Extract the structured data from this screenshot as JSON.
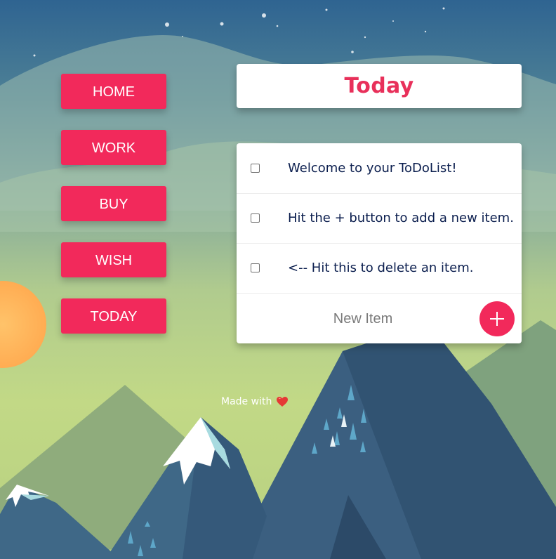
{
  "nav": {
    "items": [
      {
        "label": "HOME"
      },
      {
        "label": "WORK"
      },
      {
        "label": "BUY"
      },
      {
        "label": "WISH"
      },
      {
        "label": "TODAY"
      }
    ]
  },
  "header": {
    "title": "Today"
  },
  "todo": {
    "items": [
      {
        "text": "Welcome to your ToDoList!",
        "checked": false
      },
      {
        "text": "Hit the + button to add a new item.",
        "checked": false
      },
      {
        "text": "<-- Hit this to delete an item.",
        "checked": false
      }
    ],
    "new_item_placeholder": "New Item",
    "add_button_icon": "plus-icon"
  },
  "footer": {
    "text": "Made with",
    "icon": "heart-icon"
  },
  "colors": {
    "accent": "#f2295b",
    "title": "#e8305a",
    "item_text": "#0b1e4e",
    "card": "#ffffff"
  }
}
